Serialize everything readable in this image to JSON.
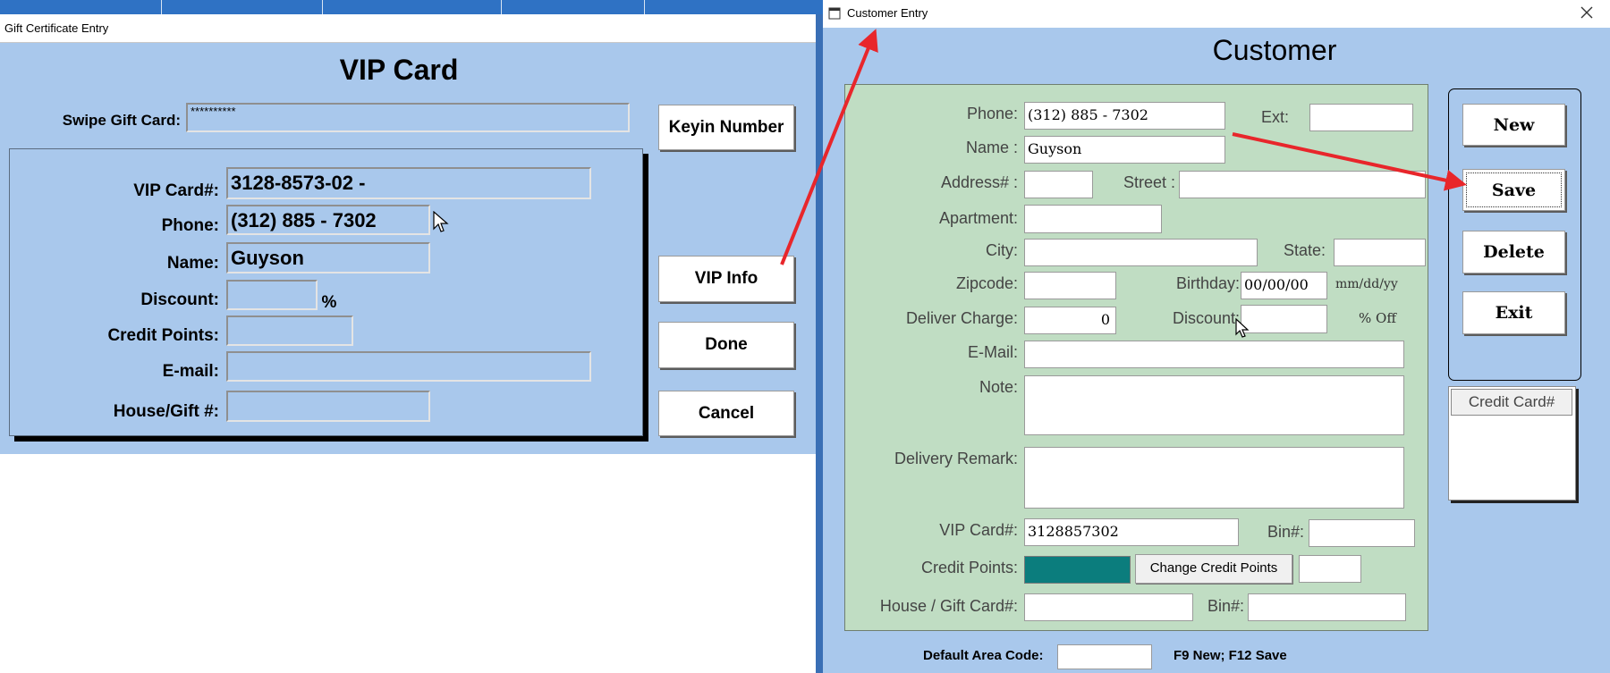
{
  "gift_window": {
    "title": "Gift Certificate  Entry",
    "heading": "VIP Card",
    "swipe_label": "Swipe Gift Card:",
    "swipe_value": "**********",
    "fields": {
      "vip_card_label": "VIP Card#:",
      "vip_card_value": "3128-8573-02  -",
      "phone_label": "Phone:",
      "phone_value": "(312) 885 - 7302",
      "name_label": "Name:",
      "name_value": "Guyson",
      "discount_label": "Discount:",
      "discount_value": "",
      "percent_sign": "%",
      "credit_points_label": "Credit Points:",
      "credit_points_value": "",
      "email_label": "E-mail:",
      "email_value": "",
      "house_gift_label": "House/Gift #:",
      "house_gift_value": ""
    },
    "buttons": {
      "keyin": "Keyin Number",
      "vip_info": "VIP Info",
      "done": "Done",
      "cancel": "Cancel"
    }
  },
  "customer_window": {
    "title": "Customer Entry",
    "heading": "Customer",
    "labels": {
      "phone": "Phone:",
      "ext": "Ext:",
      "name": "Name :",
      "address": "Address# :",
      "street": "Street :",
      "apartment": "Apartment:",
      "city": "City:",
      "state": "State:",
      "zipcode": "Zipcode:",
      "birthday": "Birthday:",
      "birthday_format": "mm/dd/yy",
      "deliver_charge": "Deliver Charge:",
      "discount": "Discount:",
      "discount_suffix": "% Off",
      "email": "E-Mail:",
      "note": "Note:",
      "delivery_remark": "Delivery Remark:",
      "vip_card": "VIP Card#:",
      "bin1": "Bin#:",
      "credit_points": "Credit Points:",
      "house_gift": "House / Gift Card#:",
      "bin2": "Bin#:"
    },
    "values": {
      "phone": "(312) 885 - 7302",
      "ext": "",
      "name": "Guyson",
      "address": "",
      "street": "",
      "apartment": "",
      "city": "",
      "state": "",
      "zipcode": "",
      "birthday": "00/00/00",
      "deliver_charge": "0",
      "discount": "",
      "email": "",
      "note": "",
      "delivery_remark": "",
      "vip_card": "3128857302",
      "bin1": "",
      "credit_points_extra": "",
      "house_gift": "",
      "bin2": "",
      "default_area_code": ""
    },
    "change_credit_points": "Change Credit Points",
    "buttons": {
      "new": "New",
      "save": "Save",
      "delete": "Delete",
      "exit": "Exit"
    },
    "credit_card_header": "Credit Card#",
    "footer": {
      "default_area_code_label": "Default Area Code:",
      "shortcut_hint": "F9 New; F12 Save"
    }
  },
  "colors": {
    "window_bg": "#a9c8ec",
    "panel_green": "#c0ddc3",
    "annotation_arrow": "#e8262b",
    "credit_points_fill": "#0b7d7d"
  }
}
